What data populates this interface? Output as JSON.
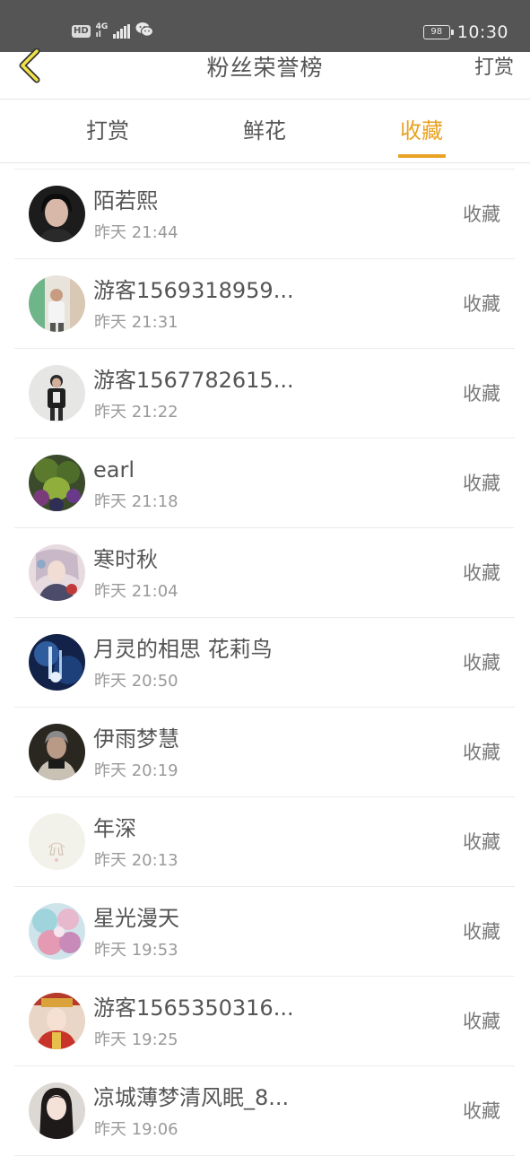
{
  "status_bar": {
    "hd": "HD",
    "net_top": "4G",
    "net_bottom": "ıl",
    "battery": "98",
    "time": "10:30"
  },
  "header": {
    "back_icon": "chevron-left-icon",
    "title": "粉丝荣誉榜",
    "right_action": "打赏"
  },
  "tabs": [
    {
      "label": "打赏",
      "active": false
    },
    {
      "label": "鲜花",
      "active": false
    },
    {
      "label": "收藏",
      "active": true
    }
  ],
  "colors": {
    "accent": "#e9a224",
    "text": "#555555",
    "subtext": "#9a9a9a",
    "status_bar_bg": "#555555"
  },
  "list": [
    {
      "name": "陌若熙",
      "time": "昨天 21:44",
      "action": "收藏"
    },
    {
      "name": "游客1569318959...",
      "time": "昨天 21:31",
      "action": "收藏"
    },
    {
      "name": "游客1567782615...",
      "time": "昨天 21:22",
      "action": "收藏"
    },
    {
      "name": "earl",
      "time": "昨天 21:18",
      "action": "收藏"
    },
    {
      "name": "寒时秋",
      "time": "昨天 21:04",
      "action": "收藏"
    },
    {
      "name": "月灵的相思 花莉鸟",
      "time": "昨天 20:50",
      "action": "收藏"
    },
    {
      "name": "伊雨梦慧",
      "time": "昨天 20:19",
      "action": "收藏"
    },
    {
      "name": "年深",
      "time": "昨天 20:13",
      "action": "收藏"
    },
    {
      "name": "星光漫天",
      "time": "昨天 19:53",
      "action": "收藏"
    },
    {
      "name": "游客1565350316...",
      "time": "昨天 19:25",
      "action": "收藏"
    },
    {
      "name": "凉城薄梦清风眠_8...",
      "time": "昨天 19:06",
      "action": "收藏"
    }
  ]
}
